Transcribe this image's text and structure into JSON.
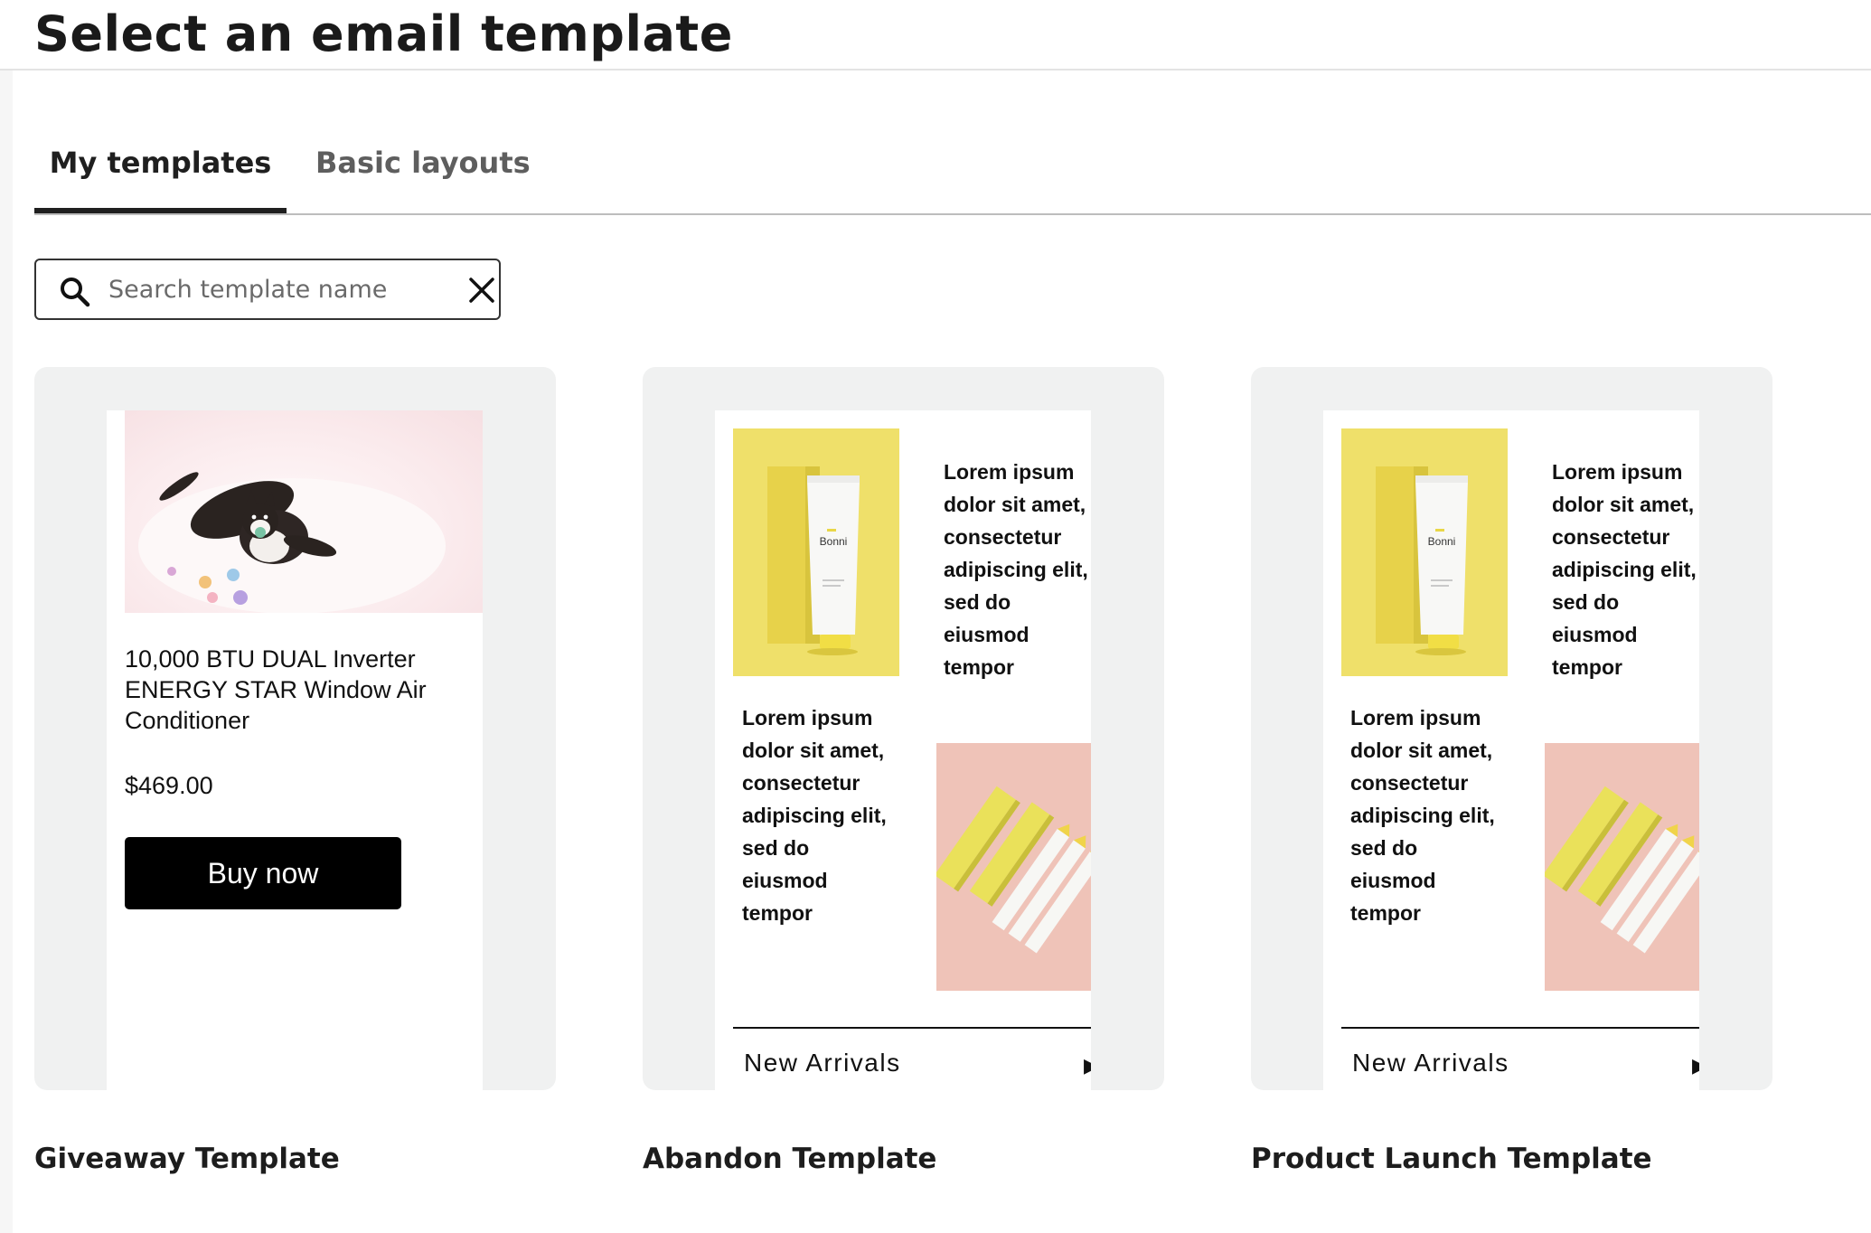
{
  "page": {
    "title": "Select an email template"
  },
  "tabs": [
    {
      "label": "My templates",
      "active": true
    },
    {
      "label": "Basic layouts",
      "active": false
    }
  ],
  "search": {
    "placeholder": "Search template name",
    "value": ""
  },
  "templates": [
    {
      "name": "Giveaway Template",
      "preview": {
        "product_title": "10,000 BTU DUAL Inverter ENERGY STAR Window Air Conditioner",
        "price": "$469.00",
        "button_label": "Buy now"
      }
    },
    {
      "name": "Abandon Template",
      "preview": {
        "text_block_1": "Lorem ipsum dolor sit amet, consectetur adipiscing elit, sed do eiusmod tempor",
        "text_block_2": "Lorem ipsum dolor sit amet, consectetur adipiscing elit, sed do eiusmod tempor",
        "product_label": "Bonni",
        "footer_text": "New Arrivals"
      }
    },
    {
      "name": "Product Launch Template",
      "preview": {
        "text_block_1": "Lorem ipsum dolor sit amet, consectetur adipiscing elit, sed do eiusmod tempor",
        "text_block_2": "Lorem ipsum dolor sit amet, consectetur adipiscing elit, sed do eiusmod tempor",
        "product_label": "Bonni",
        "footer_text": "New Arrivals"
      }
    }
  ],
  "icons": {
    "search": "search-icon",
    "clear": "close-icon"
  },
  "colors": {
    "accent": "#1f1f1f",
    "card_bg": "#f0f1f1",
    "button_bg": "#000000",
    "yellow": "#efe06a",
    "pink": "#efc3b8"
  }
}
